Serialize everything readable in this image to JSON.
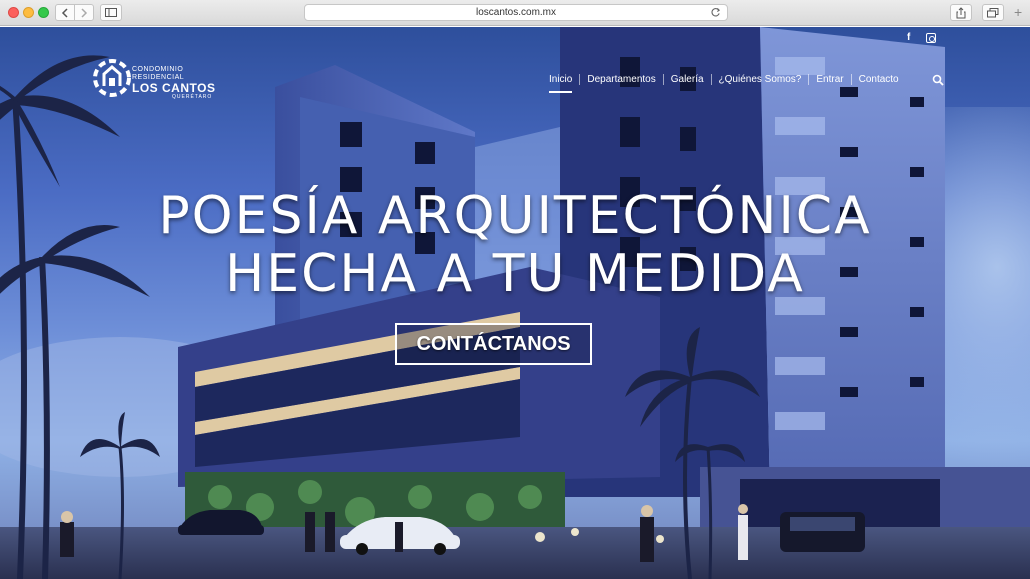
{
  "browser": {
    "url": "loscantos.com.mx",
    "icons": [
      "back-icon",
      "forward-icon",
      "sidebar-icon",
      "reload-icon",
      "share-icon",
      "tabs-icon",
      "new-tab-icon"
    ]
  },
  "site": {
    "logo": {
      "line1": "CONDOMINIO",
      "line2": "RESIDENCIAL",
      "line3": "LOS CANTOS",
      "line4": "QUERÉTARO"
    },
    "social": {
      "facebook": "f"
    },
    "nav": [
      {
        "label": "Inicio",
        "active": true
      },
      {
        "label": "Departamentos",
        "active": false
      },
      {
        "label": "Galería",
        "active": false
      },
      {
        "label": "¿Quiénes Somos?",
        "active": false
      },
      {
        "label": "Entrar",
        "active": false
      },
      {
        "label": "Contacto",
        "active": false
      }
    ],
    "headline_line1": "POESÍA ARQUITECTÓNICA",
    "headline_line2": "HECHA A TU MEDIDA",
    "cta_label": "CONTÁCTANOS"
  },
  "colors": {
    "sky_top": "#2e4f9c",
    "sky_mid": "#6e8fd8",
    "building_dark": "#2b3c80",
    "building_light": "#5d74c2",
    "window": "#0f1638",
    "warm_light": "#f2d9a6"
  }
}
